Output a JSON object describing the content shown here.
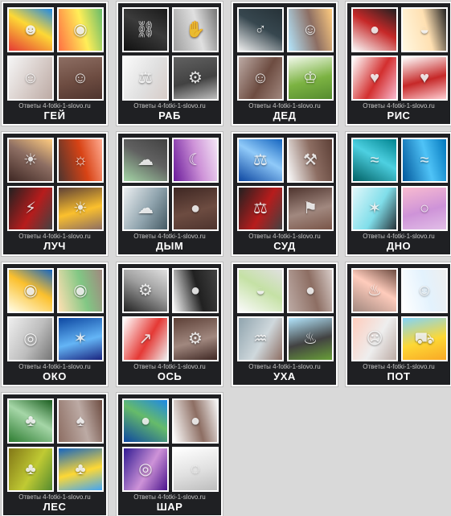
{
  "watermark": "Ответы 4-fotki-1-slovo.ru",
  "puzzles": [
    {
      "answer": "ГЕЙ",
      "tiles": [
        {
          "icon": "rainbow-heads-icon",
          "glyph": "☻",
          "colors": [
            "#e53935",
            "#fdd835",
            "#1e88e5"
          ]
        },
        {
          "icon": "rainbow-eye-icon",
          "glyph": "◉",
          "colors": [
            "#ff7043",
            "#ffee58",
            "#66bb6a"
          ]
        },
        {
          "icon": "two-men-icon",
          "glyph": "☺",
          "colors": [
            "#f5f5f5",
            "#d7ccc8",
            "#bcaaa4"
          ]
        },
        {
          "icon": "two-men-sunglasses-icon",
          "glyph": "☺",
          "colors": [
            "#8d6e63",
            "#6d4c41",
            "#4e342e"
          ]
        }
      ]
    },
    {
      "answer": "РАБ",
      "tiles": [
        {
          "icon": "chained-man-icon",
          "glyph": "⛓",
          "colors": [
            "#111111",
            "#3b3b3b",
            "#1a1a1a"
          ]
        },
        {
          "icon": "tied-hands-icon",
          "glyph": "✋",
          "colors": [
            "#9e9e9e",
            "#e0e0e0",
            "#757575"
          ]
        },
        {
          "icon": "figure-with-bags-icon",
          "glyph": "⚖",
          "colors": [
            "#fafafa",
            "#e0e0e0",
            "#d7ccc8"
          ]
        },
        {
          "icon": "robot-worker-icon",
          "glyph": "⚙",
          "colors": [
            "#616161",
            "#424242",
            "#bdbdbd"
          ]
        }
      ]
    },
    {
      "answer": "ДЕД",
      "tiles": [
        {
          "icon": "old-man-legs-icon",
          "glyph": "♂",
          "colors": [
            "#eeeeee",
            "#37474f",
            "#263238"
          ]
        },
        {
          "icon": "grandfather-child-icon",
          "glyph": "☺",
          "colors": [
            "#b3e5fc",
            "#8d6e63",
            "#ffcc80"
          ]
        },
        {
          "icon": "elderly-reading-icon",
          "glyph": "☺",
          "colors": [
            "#bcaaa4",
            "#6d4c41",
            "#a1887f"
          ]
        },
        {
          "icon": "sweater-hanger-icon",
          "glyph": "♔",
          "colors": [
            "#f1f8e9",
            "#7cb342",
            "#558b2f"
          ]
        }
      ]
    },
    {
      "answer": "РИС",
      "tiles": [
        {
          "icon": "sushi-rolls-icon",
          "glyph": "●",
          "colors": [
            "#fafafa",
            "#c62828",
            "#212121"
          ]
        },
        {
          "icon": "rice-bowl-icon",
          "glyph": "◒",
          "colors": [
            "#fff8e1",
            "#ffe0b2",
            "#212121"
          ]
        },
        {
          "icon": "rice-strawberry-icon",
          "glyph": "♥",
          "colors": [
            "#ffffff",
            "#d32f2f",
            "#f8bbd0"
          ]
        },
        {
          "icon": "rice-berries-icon",
          "glyph": "♥",
          "colors": [
            "#ffffff",
            "#c62828",
            "#ffcdd2"
          ]
        }
      ]
    },
    {
      "answer": "ЛУЧ",
      "tiles": [
        {
          "icon": "woman-lamp-icon",
          "glyph": "☀",
          "colors": [
            "#3e2723",
            "#8d6e63",
            "#ffcc80"
          ]
        },
        {
          "icon": "lighthouse-icon",
          "glyph": "☼",
          "colors": [
            "#4e342e",
            "#d84315",
            "#ffab91"
          ]
        },
        {
          "icon": "laser-device-icon",
          "glyph": "⚡",
          "colors": [
            "#212121",
            "#b71c1c",
            "#424242"
          ]
        },
        {
          "icon": "forest-light-icon",
          "glyph": "☀",
          "colors": [
            "#5d4037",
            "#fbc02d",
            "#8d6e63"
          ]
        }
      ]
    },
    {
      "answer": "ДЫМ",
      "tiles": [
        {
          "icon": "steam-train-icon",
          "glyph": "☁",
          "colors": [
            "#a5d6a7",
            "#616161",
            "#424242"
          ]
        },
        {
          "icon": "night-house-icon",
          "glyph": "☾",
          "colors": [
            "#6a1b9a",
            "#ce93d8",
            "#f3e5f5"
          ]
        },
        {
          "icon": "smoking-woman-icon",
          "glyph": "☁",
          "colors": [
            "#eceff1",
            "#90a4ae",
            "#455a64"
          ]
        },
        {
          "icon": "coffee-beans-icon",
          "glyph": "●",
          "colors": [
            "#3e2723",
            "#6d4c41",
            "#4e342e"
          ]
        }
      ]
    },
    {
      "answer": "СУД",
      "tiles": [
        {
          "icon": "justice-statue-icon",
          "glyph": "⚖",
          "colors": [
            "#0d47a1",
            "#90caf9",
            "#1565c0"
          ]
        },
        {
          "icon": "gavel-icon",
          "glyph": "⚒",
          "colors": [
            "#fafafa",
            "#8d6e63",
            "#5d4037"
          ]
        },
        {
          "icon": "judge-icon",
          "glyph": "⚖",
          "colors": [
            "#212121",
            "#b71c1c",
            "#424242"
          ]
        },
        {
          "icon": "courtroom-icon",
          "glyph": "⚑",
          "colors": [
            "#4e342e",
            "#a1887f",
            "#795548"
          ]
        }
      ]
    },
    {
      "answer": "ДНО",
      "tiles": [
        {
          "icon": "seabed-icon",
          "glyph": "≈",
          "colors": [
            "#006064",
            "#4dd0e1",
            "#00838f"
          ]
        },
        {
          "icon": "underwater-icon",
          "glyph": "≈",
          "colors": [
            "#01579b",
            "#4fc3f7",
            "#0277bd"
          ]
        },
        {
          "icon": "ice-hole-icon",
          "glyph": "✶",
          "colors": [
            "#e0f7fa",
            "#80deea",
            "#263238"
          ]
        },
        {
          "icon": "glass-bottom-icon",
          "glyph": "○",
          "colors": [
            "#f8bbd0",
            "#ce93d8",
            "#e1bee7"
          ]
        }
      ]
    },
    {
      "answer": "ОКО",
      "tiles": [
        {
          "icon": "eye-ornament-icon",
          "glyph": "◉",
          "colors": [
            "#fffde7",
            "#fbc02d",
            "#1565c0"
          ]
        },
        {
          "icon": "woman-eye-icon",
          "glyph": "◉",
          "colors": [
            "#ffe0b2",
            "#81c784",
            "#a1887f"
          ]
        },
        {
          "icon": "camera-lens-icon",
          "glyph": "◎",
          "colors": [
            "#eeeeee",
            "#bdbdbd",
            "#757575"
          ]
        },
        {
          "icon": "cosmic-eye-icon",
          "glyph": "✶",
          "colors": [
            "#0d47a1",
            "#64b5f6",
            "#1a237e"
          ]
        }
      ]
    },
    {
      "answer": "ОСЬ",
      "tiles": [
        {
          "icon": "bicycle-hub-icon",
          "glyph": "⚙",
          "colors": [
            "#212121",
            "#9e9e9e",
            "#e0e0e0"
          ]
        },
        {
          "icon": "globe-icon",
          "glyph": "●",
          "colors": [
            "#fafafa",
            "#212121",
            "#424242"
          ]
        },
        {
          "icon": "growth-chart-icon",
          "glyph": "↗",
          "colors": [
            "#ffffff",
            "#e53935",
            "#eeeeee"
          ]
        },
        {
          "icon": "machinery-icon",
          "glyph": "⚙",
          "colors": [
            "#5d4037",
            "#a1887f",
            "#3e2723"
          ]
        }
      ]
    },
    {
      "answer": "УХА",
      "tiles": [
        {
          "icon": "soup-bowl-icon",
          "glyph": "◒",
          "colors": [
            "#fafafa",
            "#c5e1a5",
            "#e0e0e0"
          ]
        },
        {
          "icon": "potatoes-icon",
          "glyph": "●",
          "colors": [
            "#bcaaa4",
            "#8d6e63",
            "#d7ccc8"
          ]
        },
        {
          "icon": "fisherman-icon",
          "glyph": "♒",
          "colors": [
            "#90a4ae",
            "#cfd8dc",
            "#8d6e63"
          ]
        },
        {
          "icon": "campfire-pot-icon",
          "glyph": "♨",
          "colors": [
            "#b3e5fc",
            "#424242",
            "#689f38"
          ]
        }
      ]
    },
    {
      "answer": "ПОТ",
      "tiles": [
        {
          "icon": "sauna-man-icon",
          "glyph": "♨",
          "colors": [
            "#a1887f",
            "#ffccbc",
            "#6d4c41"
          ]
        },
        {
          "icon": "sweating-man-icon",
          "glyph": "☺",
          "colors": [
            "#ffffff",
            "#e3f2fd",
            "#eeeeee"
          ]
        },
        {
          "icon": "tired-woman-icon",
          "glyph": "☹",
          "colors": [
            "#ffccbc",
            "#eeeeee",
            "#bcaaa4"
          ]
        },
        {
          "icon": "taxi-car-icon",
          "glyph": "⛟",
          "colors": [
            "#81d4fa",
            "#fdd835",
            "#f9a825"
          ]
        }
      ]
    },
    {
      "answer": "ЛЕС",
      "tiles": [
        {
          "icon": "green-forest-icon",
          "glyph": "♣",
          "colors": [
            "#2e7d32",
            "#a5d6a7",
            "#1b5e20"
          ]
        },
        {
          "icon": "bare-tree-icon",
          "glyph": "♠",
          "colors": [
            "#8d6e63",
            "#bcaaa4",
            "#6d4c41"
          ]
        },
        {
          "icon": "mossy-forest-icon",
          "glyph": "♣",
          "colors": [
            "#827717",
            "#c0ca33",
            "#558b2f"
          ]
        },
        {
          "icon": "blue-tree-icon",
          "glyph": "♣",
          "colors": [
            "#1565c0",
            "#fdd835",
            "#42a5f5"
          ]
        }
      ]
    },
    {
      "answer": "ШАР",
      "tiles": [
        {
          "icon": "earth-sphere-icon",
          "glyph": "●",
          "colors": [
            "#0d47a1",
            "#66bb6a",
            "#1e88e5"
          ]
        },
        {
          "icon": "walnut-balls-icon",
          "glyph": "●",
          "colors": [
            "#ffffff",
            "#8d6e63",
            "#f5f5f5"
          ]
        },
        {
          "icon": "crystal-ball-icon",
          "glyph": "◎",
          "colors": [
            "#311b92",
            "#ce93d8",
            "#4a148c"
          ]
        },
        {
          "icon": "disco-ball-icon",
          "glyph": "◌",
          "colors": [
            "#ffffff",
            "#e0e0e0",
            "#bdbdbd"
          ]
        }
      ]
    }
  ]
}
